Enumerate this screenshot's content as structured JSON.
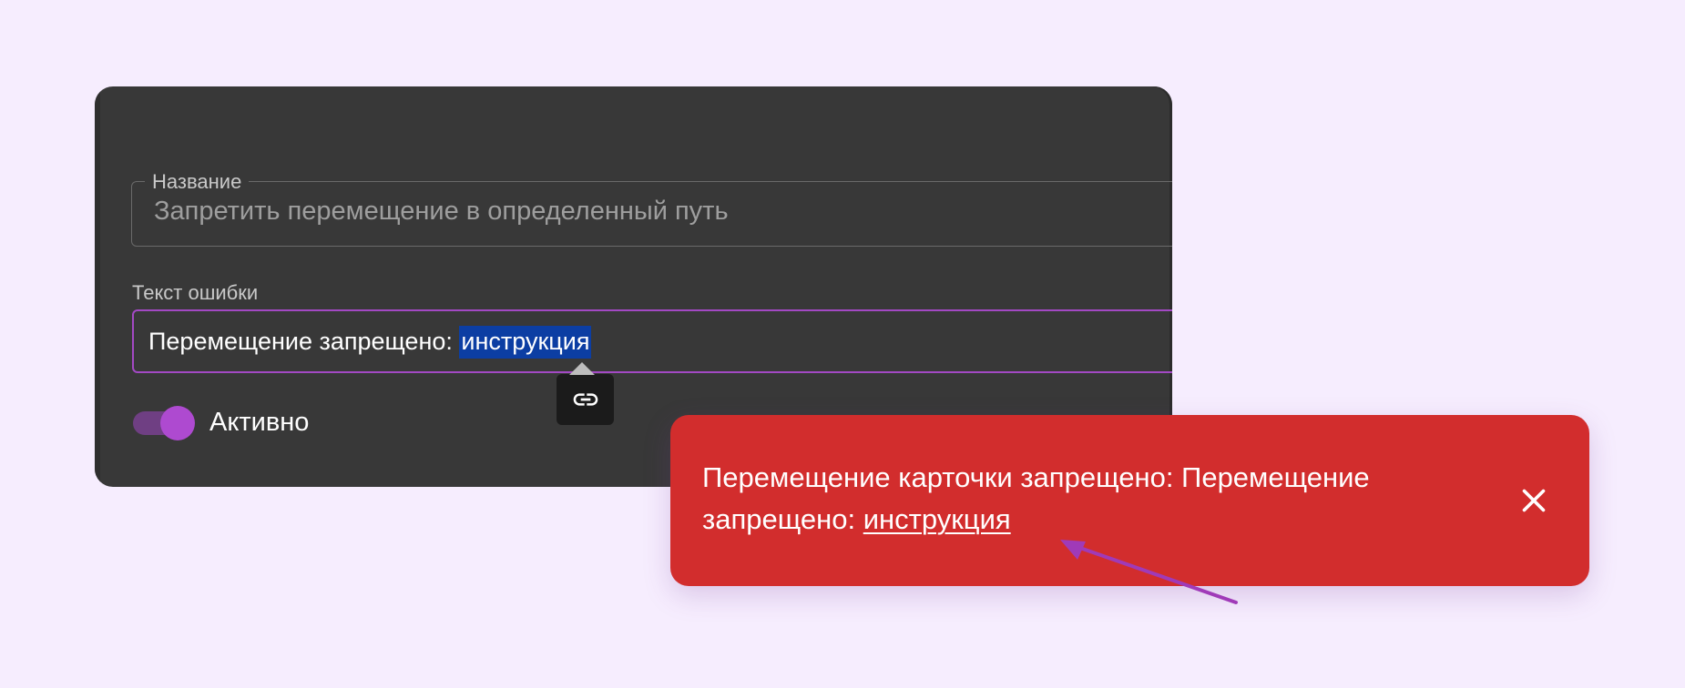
{
  "dialog": {
    "name_field": {
      "label": "Название",
      "value": "Запретить перемещение в определенный путь"
    },
    "error_field": {
      "label": "Текст ошибки",
      "text_prefix": "Перемещение запрещено: ",
      "selected_text": "инструкция"
    },
    "link_tooltip": {
      "icon": "link-icon"
    },
    "active_toggle": {
      "label": "Активно",
      "on": true
    }
  },
  "snackbar": {
    "message_prefix": "Перемещение карточки запрещено: Перемещение запрещено: ",
    "link_text": "инструкция",
    "close_icon": "close-icon"
  },
  "colors": {
    "page_background": "#f6edfe",
    "panel_background": "#383838",
    "accent": "#a349c4",
    "selection": "#0c3ea3",
    "snackbar_background": "#d22d2d",
    "annotation_arrow": "#a03ab8"
  }
}
